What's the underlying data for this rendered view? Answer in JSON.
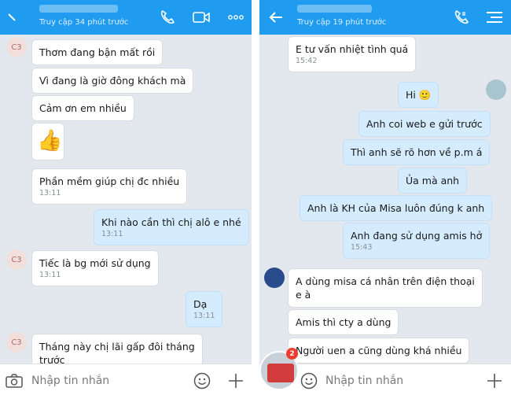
{
  "left": {
    "status": "Truy cập 34 phút trước",
    "avatar_initials": "C3",
    "input_placeholder": "Nhập tin nhắn",
    "messages": [
      {
        "text": "Thơm đang bận mất rồi"
      },
      {
        "text": "Vì đang là giờ đông khách mà"
      },
      {
        "text": "Cảm ơn em nhiều"
      },
      {
        "sticker": "👍"
      },
      {
        "text": "Phần mềm giúp chị đc nhiều",
        "time": "13:11"
      },
      {
        "text": "Khi nào cần thì chị alô e nhé",
        "time": "13:11"
      },
      {
        "text": "Tiếc là bg mới sử dụng",
        "time": "13:11"
      },
      {
        "text": "Dạ",
        "time": "13:11"
      },
      {
        "text": "Tháng này chị lãi gấp đôi tháng",
        "text2": "trước"
      }
    ]
  },
  "right": {
    "status": "Truy cập 19 phút trước",
    "input_placeholder": "Nhập tin nhắn",
    "badge_count": "2",
    "messages": [
      {
        "text": "E tư vấn nhiệt tình quá",
        "time": "15:42"
      },
      {
        "text": "Hi 🙂"
      },
      {
        "text": "Anh coi web e gửi trước"
      },
      {
        "text": "Thì anh sẽ  rõ hơn về p.m á"
      },
      {
        "text": "Ủa  mà anh"
      },
      {
        "text": "Anh là KH của Misa luôn đúng k anh"
      },
      {
        "text": "Anh đang sử dụng amis hở",
        "time": "15:43"
      },
      {
        "text": "A dùng misa cá nhân trên điện thoại",
        "text2": "e à"
      },
      {
        "text": "Amis thì cty a dùng"
      },
      {
        "text": "Người uen a cũng dùng khá nhiều"
      }
    ]
  },
  "colors": {
    "header": "#1f9bf0",
    "outgoing": "#d4ecfd",
    "incoming": "#ffffff",
    "background": "#e3e8ee"
  }
}
